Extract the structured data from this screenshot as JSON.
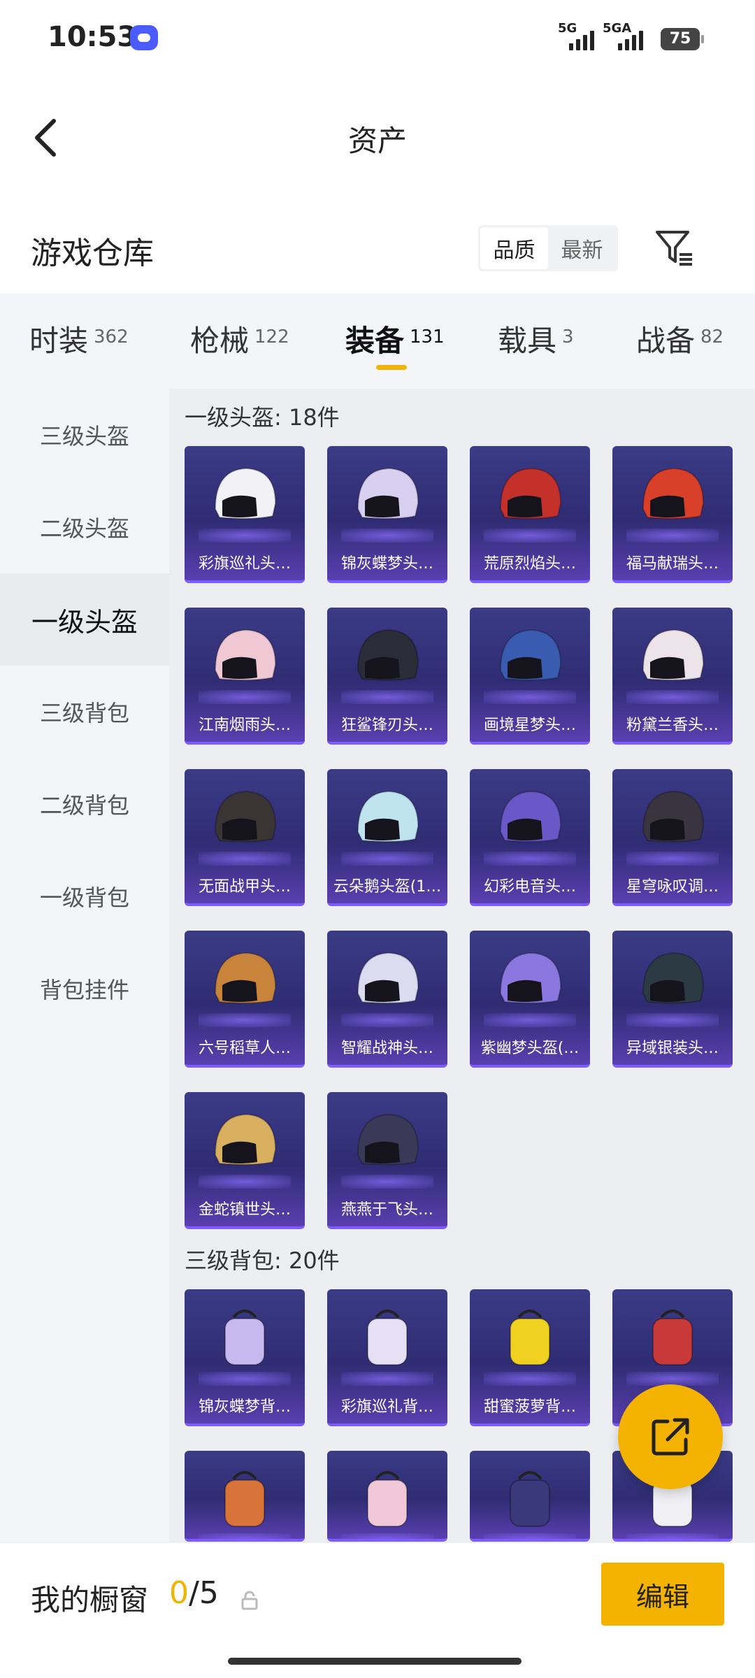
{
  "status_bar": {
    "time": "10:53",
    "signal_1": "5G",
    "signal_2": "5GA",
    "battery": "75"
  },
  "nav": {
    "title": "资产"
  },
  "header": {
    "title": "游戏仓库",
    "sort_options": [
      "品质",
      "最新"
    ],
    "sort_active": "品质"
  },
  "tabs": [
    {
      "label": "时装",
      "count": "362"
    },
    {
      "label": "枪械",
      "count": "122"
    },
    {
      "label": "装备",
      "count": "131"
    },
    {
      "label": "载具",
      "count": "3"
    },
    {
      "label": "战备",
      "count": "82"
    }
  ],
  "active_tab": "装备",
  "sidebar": {
    "items": [
      "三级头盔",
      "二级头盔",
      "一级头盔",
      "三级背包",
      "二级背包",
      "一级背包",
      "背包挂件"
    ],
    "active": "一级头盔"
  },
  "groups": [
    {
      "label": "一级头盔: 18件",
      "items": [
        "彩旗巡礼头…",
        "锦灰蝶梦头…",
        "荒原烈焰头…",
        "福马献瑞头…",
        "江南烟雨头…",
        "狂鲨锋刃头…",
        "画境星梦头…",
        "粉黛兰香头…",
        "无面战甲头…",
        "云朵鹅头盔(1…",
        "幻彩电音头…",
        "星穹咏叹调…",
        "六号稻草人…",
        "智耀战神头…",
        "紫幽梦头盔(…",
        "异域银装头…",
        "金蛇镇世头…",
        "燕燕于飞头…"
      ]
    },
    {
      "label": "三级背包: 20件",
      "items": [
        "锦灰蝶梦背…",
        "彩旗巡礼背…",
        "甜蜜菠萝背…",
        ""
      ]
    }
  ],
  "bottom_bar": {
    "showcase_label": "我的橱窗",
    "showcase_current": "0",
    "showcase_total": "/5",
    "edit_label": "编辑"
  },
  "colors": {
    "accent": "#f5b301",
    "card_bg": "#34317a",
    "card_edge": "#7a5cff"
  }
}
